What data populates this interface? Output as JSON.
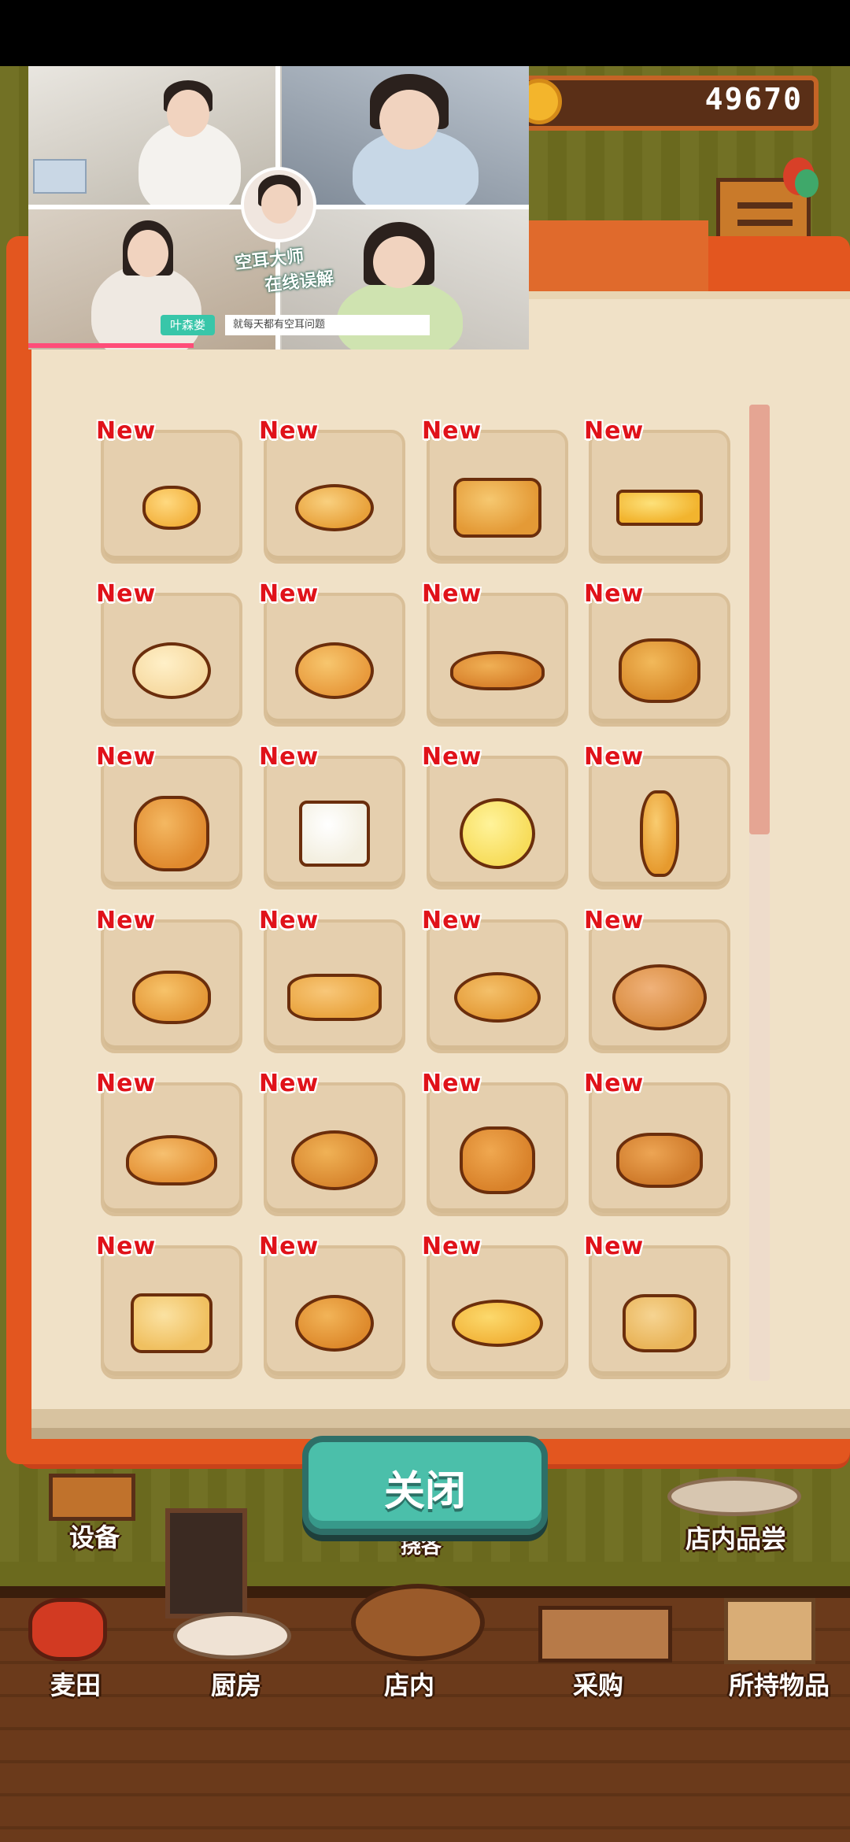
{
  "header": {
    "coins": "49670"
  },
  "video": {
    "caption_line1": "空耳大师",
    "caption_line2": "在线误解",
    "name_tag": "叶森娄",
    "subtitle": "就每天都有空耳问题"
  },
  "collection": {
    "badge_label": "New",
    "items": [
      {
        "badge": "New",
        "icon": "small-round-bun-icon"
      },
      {
        "badge": "New",
        "icon": "bread-roll-icon"
      },
      {
        "badge": "New",
        "icon": "loaf-bread-icon"
      },
      {
        "badge": "New",
        "icon": "castella-cake-icon"
      },
      {
        "badge": "New",
        "icon": "bagel-icon"
      },
      {
        "badge": "New",
        "icon": "donut-icon"
      },
      {
        "badge": "New",
        "icon": "croissant-icon"
      },
      {
        "badge": "New",
        "icon": "danish-pastry-icon"
      },
      {
        "badge": "New",
        "icon": "bunny-bread-icon"
      },
      {
        "badge": "New",
        "icon": "sandwich-icon"
      },
      {
        "badge": "New",
        "icon": "melon-pan-icon"
      },
      {
        "badge": "New",
        "icon": "baguette-icon"
      },
      {
        "badge": "New",
        "icon": "sprinkle-tart-icon"
      },
      {
        "badge": "New",
        "icon": "topped-focaccia-icon"
      },
      {
        "badge": "New",
        "icon": "oval-bun-icon"
      },
      {
        "badge": "New",
        "icon": "jam-danish-icon"
      },
      {
        "badge": "New",
        "icon": "cornet-icon"
      },
      {
        "badge": "New",
        "icon": "herb-bread-icon"
      },
      {
        "badge": "New",
        "icon": "bear-bread-icon"
      },
      {
        "badge": "New",
        "icon": "chocolate-pastry-icon"
      },
      {
        "badge": "New",
        "icon": "egg-toast-icon"
      },
      {
        "badge": "New",
        "icon": "apple-pie-icon"
      },
      {
        "badge": "New",
        "icon": "cream-croissant-icon"
      },
      {
        "badge": "New",
        "icon": "burger-icon"
      }
    ]
  },
  "close_button": "关闭",
  "scene_labels": {
    "equipment": "设备",
    "tasting": "店内品尝",
    "partial": "挠各"
  },
  "bottom_nav": [
    {
      "label": "麦田",
      "icon": "wheat-field-icon"
    },
    {
      "label": "厨房",
      "icon": "kitchen-icon"
    },
    {
      "label": "店内",
      "icon": "store-icon"
    },
    {
      "label": "采购",
      "icon": "purchase-icon"
    },
    {
      "label": "所持物品",
      "icon": "inventory-box-icon"
    }
  ],
  "colors": {
    "accent_orange": "#e3561f",
    "page": "#f0e1c7",
    "new_badge": "#e0121a",
    "close_button": "#4bbfaa"
  }
}
